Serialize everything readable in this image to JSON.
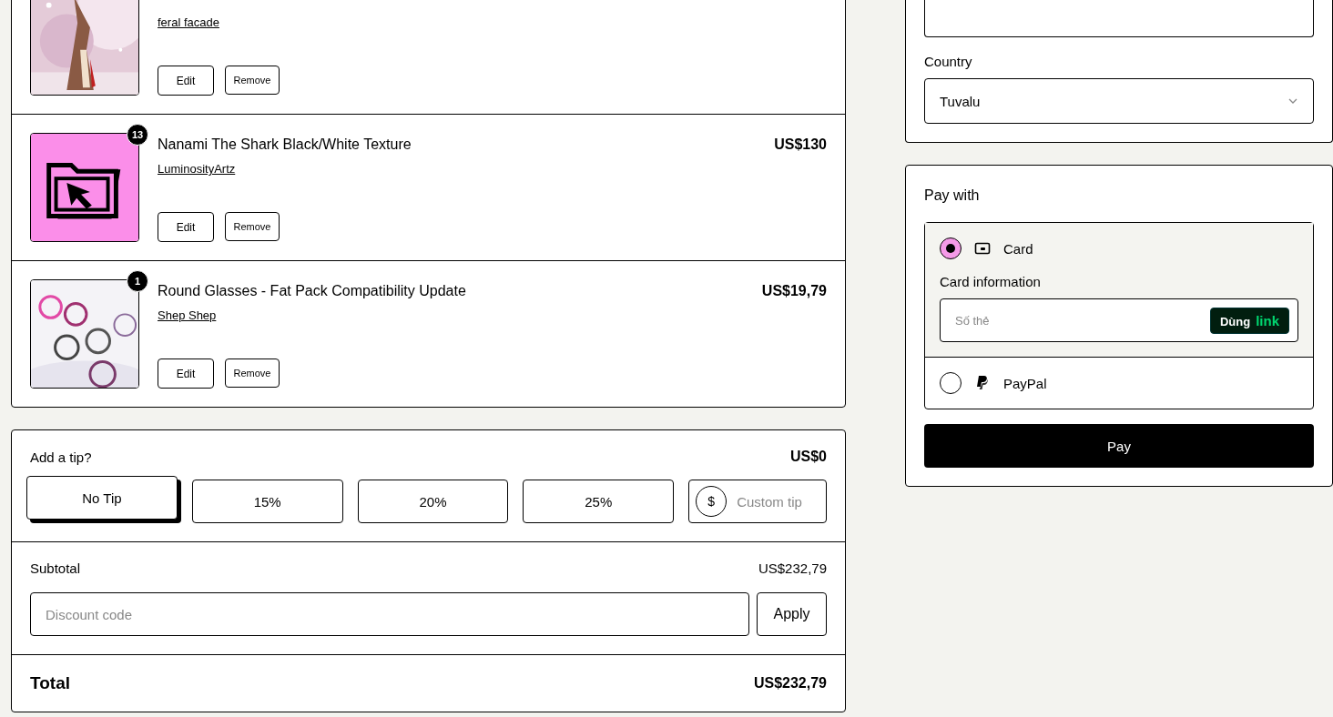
{
  "cart": {
    "items": [
      {
        "creator": "feral facade",
        "edit": "Edit",
        "remove": "Remove"
      },
      {
        "title": "Nanami The Shark Black/White Texture",
        "creator": "LuminosityArtz",
        "price": "US$130",
        "edit": "Edit",
        "remove": "Remove",
        "badge": "13"
      },
      {
        "title": "Round Glasses - Fat Pack Compatibility Update",
        "creator": "Shep Shep",
        "price": "US$19,79",
        "edit": "Edit",
        "remove": "Remove",
        "badge": "1"
      }
    ]
  },
  "tip": {
    "label": "Add a tip?",
    "amount": "US$0",
    "options": [
      {
        "label": "No Tip",
        "selected": true
      },
      {
        "label": "15%",
        "selected": false
      },
      {
        "label": "20%",
        "selected": false
      },
      {
        "label": "25%",
        "selected": false
      }
    ],
    "custom": {
      "symbol": "$",
      "placeholder": "Custom tip"
    }
  },
  "subtotal": {
    "label": "Subtotal",
    "value": "US$232,79"
  },
  "discount": {
    "placeholder": "Discount code",
    "button": "Apply"
  },
  "total": {
    "label": "Total",
    "value": "US$232,79"
  },
  "address": {
    "country_label": "Country",
    "country": "Tuvalu"
  },
  "payment": {
    "title": "Pay with",
    "methods": [
      {
        "kind": "card",
        "label": "Card",
        "selected": true,
        "info_label": "Card information",
        "placeholder": "Số thẻ",
        "link_text": "Dùng",
        "link_brand": "link"
      },
      {
        "kind": "paypal",
        "label": "PayPal",
        "selected": false
      }
    ],
    "pay_button": "Pay"
  }
}
